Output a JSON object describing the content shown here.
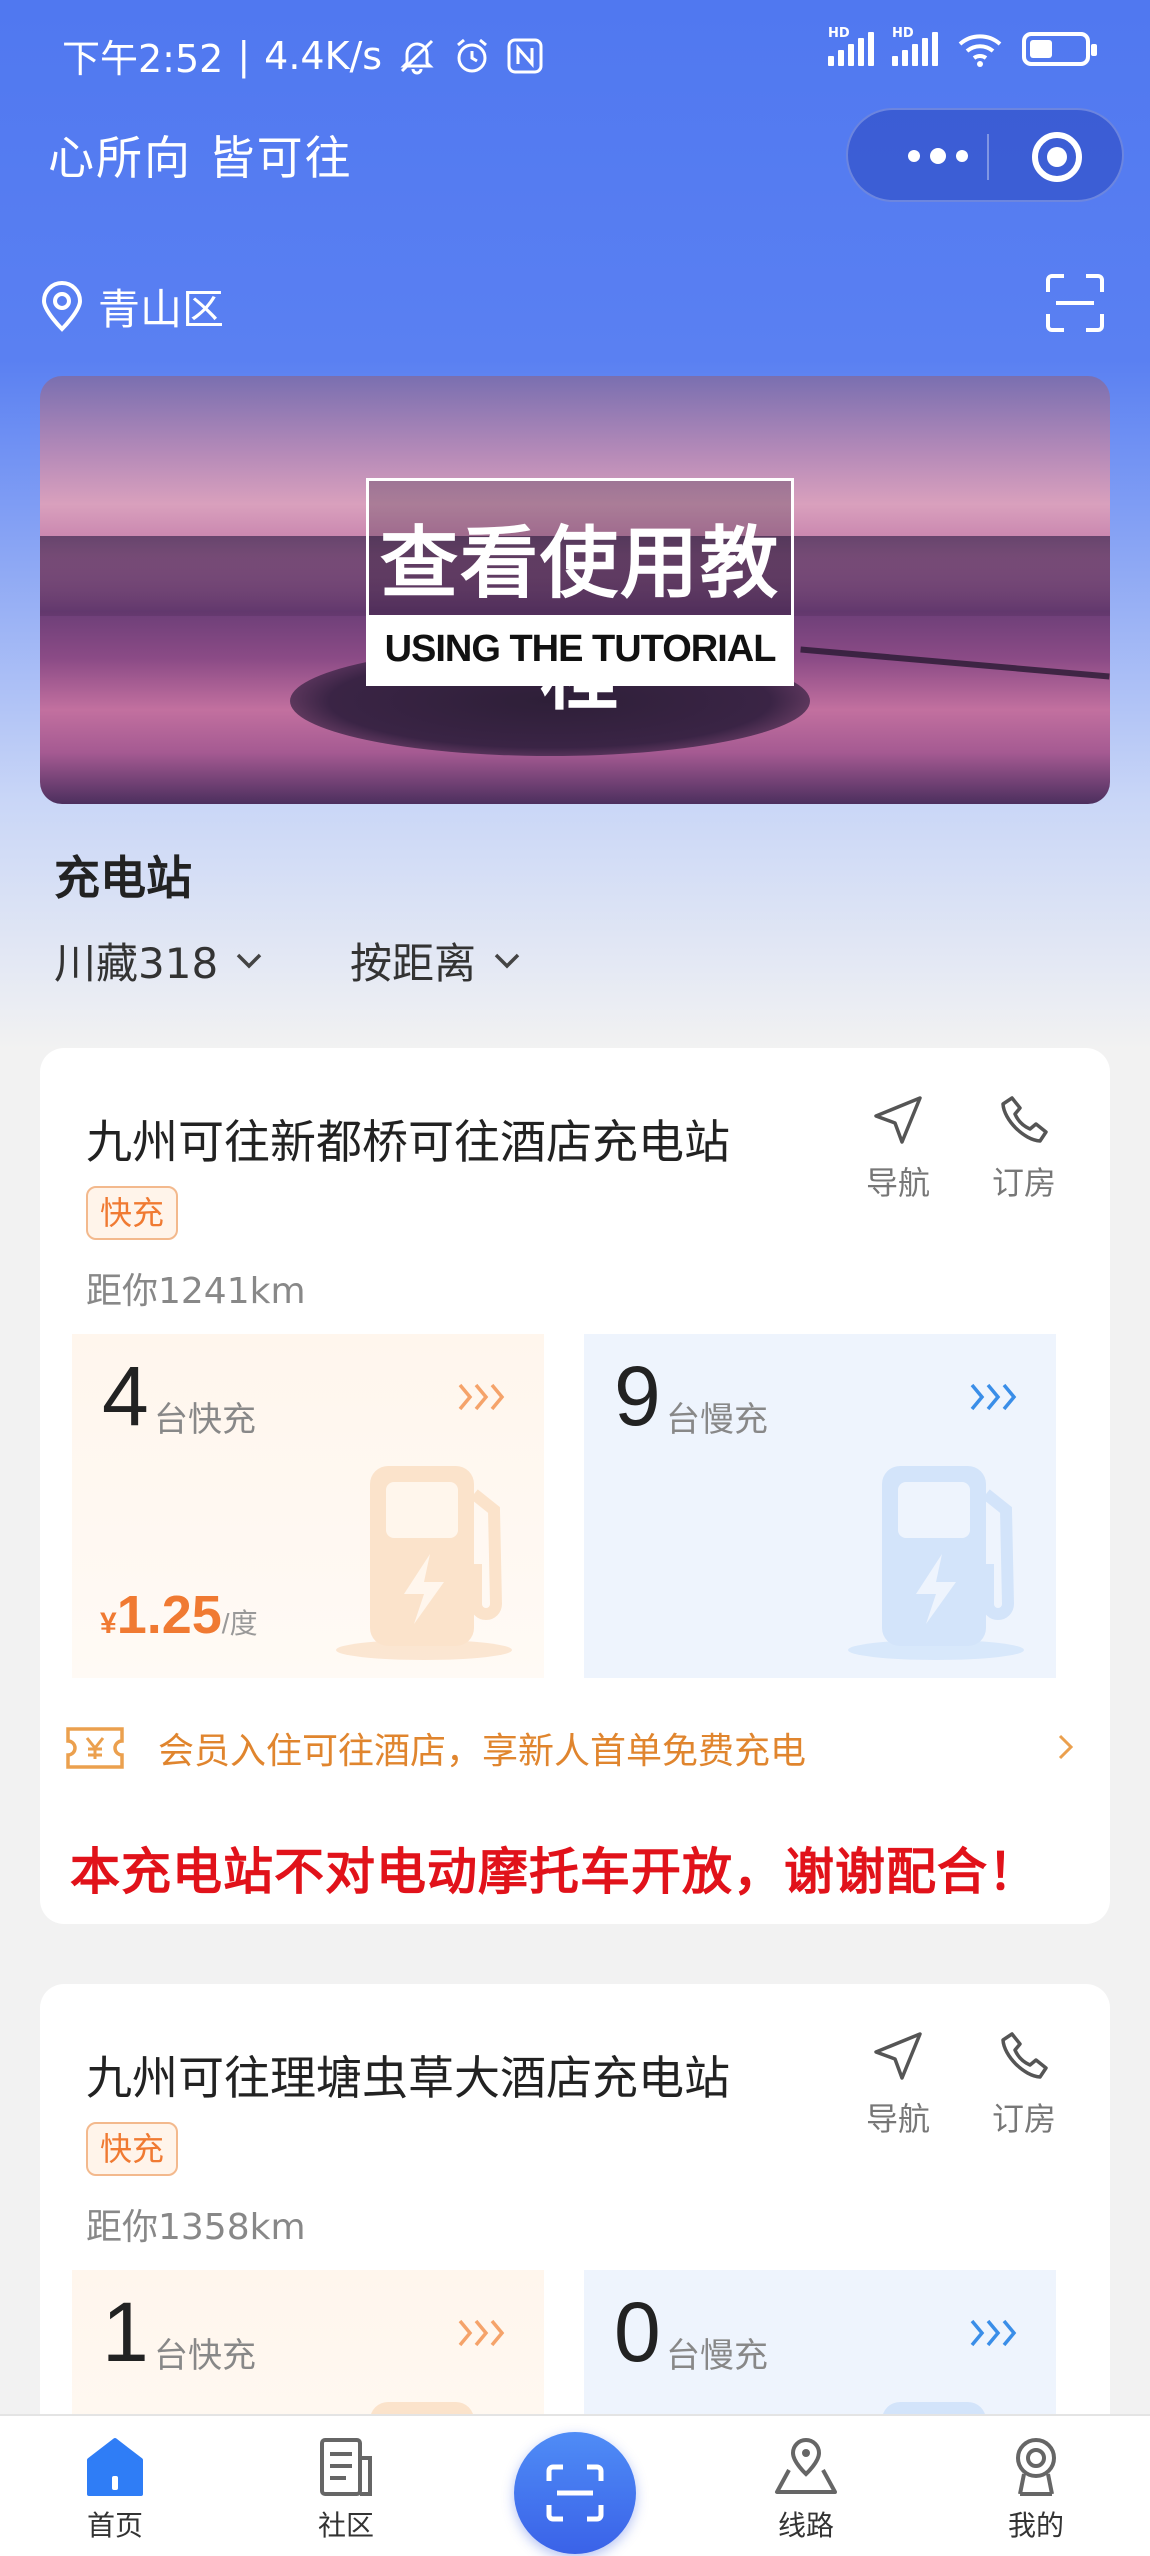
{
  "status_bar": {
    "time": "下午2:52",
    "network_speed": "4.4K/s",
    "hd_label": "HD"
  },
  "header": {
    "title": "心所向 皆可往"
  },
  "location": {
    "city": "青山区"
  },
  "banner": {
    "title_cn": "查看使用教程",
    "title_en": "USING THE TUTORIAL"
  },
  "section": {
    "title": "充电站",
    "filter_route": "川藏318",
    "filter_sort": "按距离"
  },
  "stations": [
    {
      "name": "九州可往新都桥可往酒店充电站",
      "tag": "快充",
      "distance": "距你1241km",
      "nav_label": "导航",
      "book_label": "订房",
      "fast_count": "4",
      "fast_unit": "台快充",
      "slow_count": "9",
      "slow_unit": "台慢充",
      "price_symbol": "¥",
      "price_value": "1.25",
      "price_unit": "/度",
      "promo": "会员入住可往酒店，享新人首单免费充电",
      "notice": "本充电站不对电动摩托车开放，谢谢配合！"
    },
    {
      "name": "九州可往理塘虫草大酒店充电站",
      "tag": "快充",
      "distance": "距你1358km",
      "nav_label": "导航",
      "book_label": "订房",
      "fast_count": "1",
      "fast_unit": "台快充",
      "slow_count": "0",
      "slow_unit": "台慢充"
    }
  ],
  "tabbar": {
    "home": "首页",
    "community": "社区",
    "route": "线路",
    "mine": "我的"
  },
  "colors": {
    "header_blue": "#5078f0",
    "fast_orange": "#f07a32",
    "slow_blue": "#3a8ee8",
    "notice_red": "#e1121a",
    "tab_active": "#2f7df6"
  }
}
